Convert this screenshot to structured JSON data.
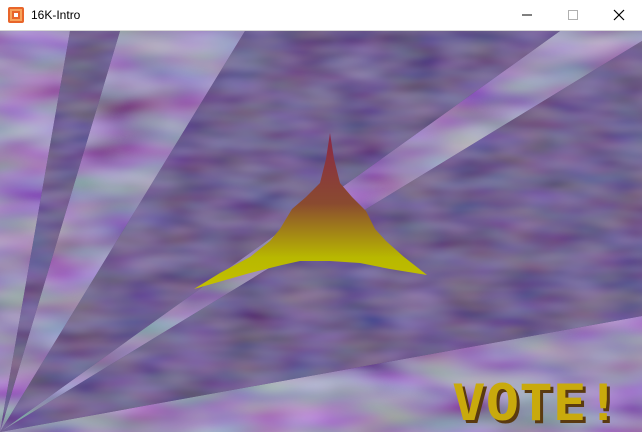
{
  "window": {
    "title": "16K-Intro",
    "app_icon": "demo-app-icon",
    "controls": {
      "minimize_icon": "minimize-icon",
      "maximize_icon": "maximize-icon",
      "close_icon": "close-icon"
    }
  },
  "scene": {
    "background_base_color": "#2e4a68",
    "background_purple_color": "#4d1e5a",
    "background_green_color": "#1f7a56",
    "ray_color": "#3a1d5a",
    "pyramid_top_color": "#8a2848",
    "pyramid_base_color": "#b8b800",
    "vote_text": "VOTE!",
    "vote_text_color": "#c9aa0c",
    "vote_shadow_color": "#5a3a10"
  }
}
